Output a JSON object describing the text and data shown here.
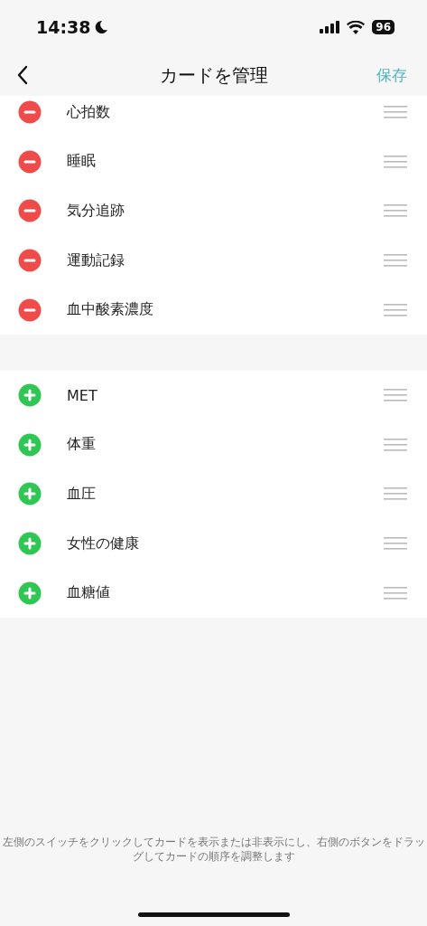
{
  "status_bar": {
    "time": "14:38",
    "battery": "96"
  },
  "nav": {
    "title": "カードを管理",
    "action": "保存"
  },
  "sections": [
    {
      "items": [
        {
          "label": "心拍数",
          "kind": "remove"
        },
        {
          "label": "睡眠",
          "kind": "remove"
        },
        {
          "label": "気分追跡",
          "kind": "remove"
        },
        {
          "label": "運動記録",
          "kind": "remove"
        },
        {
          "label": "血中酸素濃度",
          "kind": "remove"
        }
      ]
    },
    {
      "items": [
        {
          "label": "MET",
          "kind": "add"
        },
        {
          "label": "体重",
          "kind": "add"
        },
        {
          "label": "血圧",
          "kind": "add"
        },
        {
          "label": "女性の健康",
          "kind": "add"
        },
        {
          "label": "血糖値",
          "kind": "add"
        }
      ]
    }
  ],
  "footer_note": "左側のスイッチをクリックしてカードを表示または非表示にし、右側のボタンをドラッグしてカードの順序を調整します"
}
